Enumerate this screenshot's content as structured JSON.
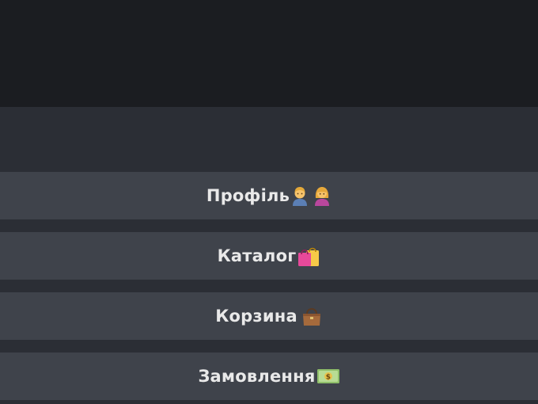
{
  "menu": {
    "profile": {
      "label": "Профіль",
      "icons": [
        "man-emoji-icon",
        "woman-emoji-icon"
      ]
    },
    "catalog": {
      "label": "Каталог",
      "icons": [
        "shopping-bags-icon"
      ]
    },
    "cart": {
      "label": "Корзина",
      "icons": [
        "handbag-icon"
      ]
    },
    "orders": {
      "label": "Замовлення",
      "icons": [
        "banknote-icon"
      ]
    }
  }
}
